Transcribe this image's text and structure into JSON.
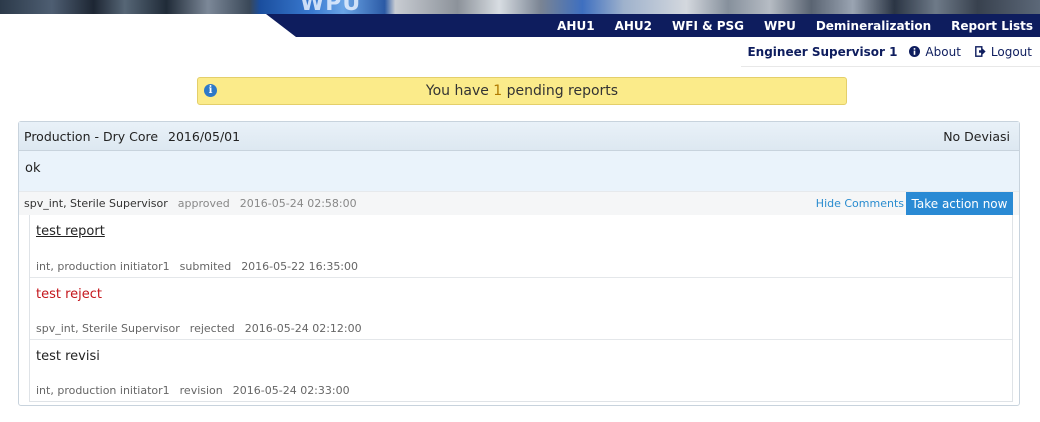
{
  "header": {
    "brand_watermark": "WPU",
    "nav": [
      "AHU1",
      "AHU2",
      "WFI & PSG",
      "WPU",
      "Demineralization",
      "Report Lists"
    ]
  },
  "userbar": {
    "user_name": "Engineer Supervisor 1",
    "about_label": "About",
    "logout_label": "Logout"
  },
  "alert": {
    "prefix": "You have ",
    "count": "1",
    "suffix": " pending reports",
    "icon": "info-icon"
  },
  "report": {
    "department": "Production - Dry Core",
    "date": "2016/05/01",
    "deviation_status": "No Deviasi",
    "body": "ok",
    "approval": {
      "user": "spv_int, Sterile Supervisor",
      "status": "approved",
      "timestamp": "2016-05-24 02:58:00"
    },
    "hide_comments_label": "Hide Comments",
    "action_label": "Take action now",
    "comments": [
      {
        "title": "test report",
        "user": "int, production initiator1",
        "status": "submited",
        "timestamp": "2016-05-22 16:35:00"
      },
      {
        "title": "test reject",
        "user": "spv_int, Sterile Supervisor",
        "status": "rejected",
        "timestamp": "2016-05-24 02:12:00"
      },
      {
        "title": "test revisi",
        "user": "int, production initiator1",
        "status": "revision",
        "timestamp": "2016-05-24 02:33:00"
      }
    ]
  },
  "colors": {
    "nav_bg": "#0e1d5e",
    "alert_bg": "#fbeb8a",
    "action_button": "#2a8ad4",
    "reject_text": "#c4161c"
  }
}
